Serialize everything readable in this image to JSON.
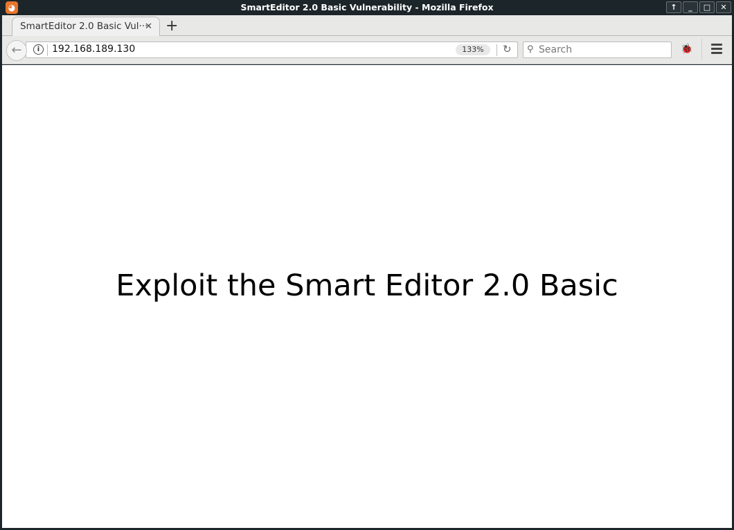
{
  "window": {
    "title": "SmartEditor 2.0 Basic Vulnerability - Mozilla Firefox",
    "buttons": [
      "↑",
      "_",
      "□",
      "✕"
    ]
  },
  "tab": {
    "label": "SmartEditor 2.0 Basic Vul···",
    "close": "✕",
    "new_tab": "+"
  },
  "nav": {
    "url": "192.168.189.130",
    "zoom": "133%",
    "search_placeholder": "Search"
  },
  "page": {
    "heading": "Exploit the Smart Editor 2.0 Basic"
  }
}
